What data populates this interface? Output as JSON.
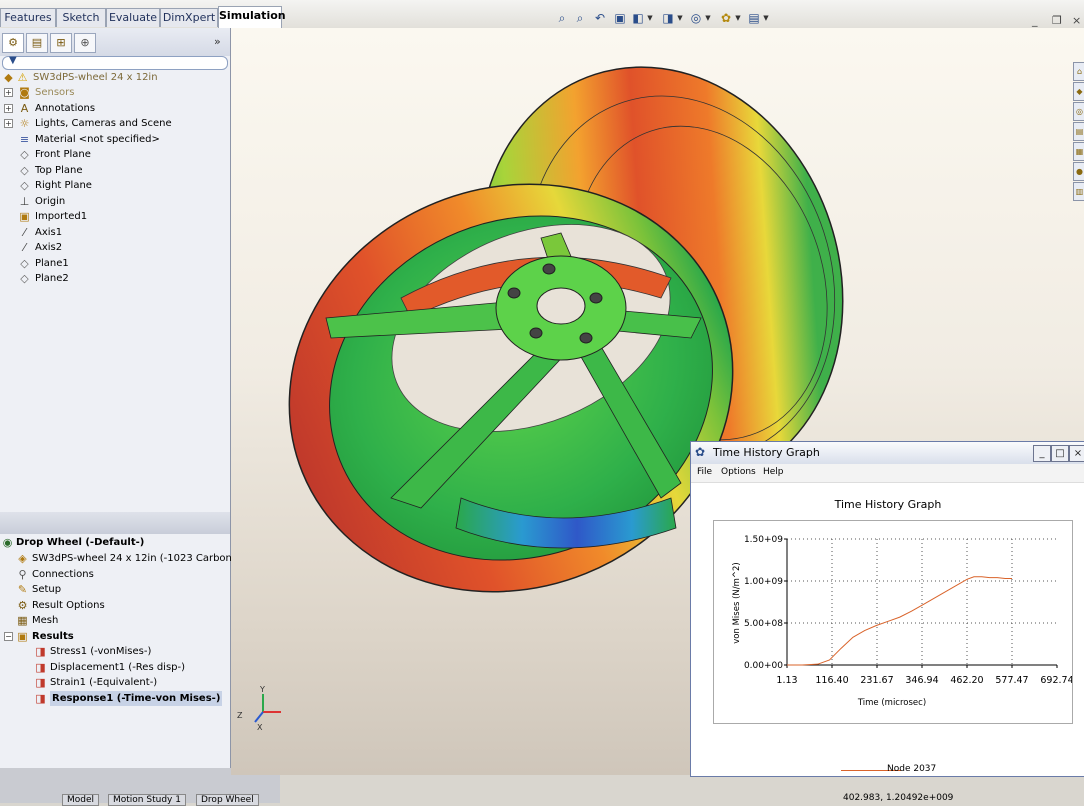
{
  "command_tabs": [
    "Features",
    "Sketch",
    "Evaluate",
    "DimXpert",
    "Simulation"
  ],
  "active_tab": "Simulation",
  "view_toolbar": [
    "zoom-to-fit-icon",
    "zoom-area-icon",
    "previous-view-icon",
    "section-view-icon",
    "view-orientation-icon",
    "display-style-icon",
    "hide-show-icon",
    "edit-appearance-icon",
    "apply-scene-icon",
    "view-settings-icon"
  ],
  "feature_tree": {
    "root": "SW3dPS-wheel 24 x 12in",
    "items": [
      {
        "label": "Sensors",
        "icon": "sensors-icon",
        "expandable": true,
        "muted": true
      },
      {
        "label": "Annotations",
        "icon": "annotations-icon",
        "expandable": true
      },
      {
        "label": "Lights, Cameras and Scene",
        "icon": "lights-icon",
        "expandable": true
      },
      {
        "label": "Material <not specified>",
        "icon": "material-icon",
        "expandable": false
      },
      {
        "label": "Front Plane",
        "icon": "plane-icon",
        "expandable": false
      },
      {
        "label": "Top Plane",
        "icon": "plane-icon",
        "expandable": false
      },
      {
        "label": "Right Plane",
        "icon": "plane-icon",
        "expandable": false
      },
      {
        "label": "Origin",
        "icon": "origin-icon",
        "expandable": false
      },
      {
        "label": "Imported1",
        "icon": "imported-icon",
        "expandable": false
      },
      {
        "label": "Axis1",
        "icon": "axis-icon",
        "expandable": false
      },
      {
        "label": "Axis2",
        "icon": "axis-icon",
        "expandable": false
      },
      {
        "label": "Plane1",
        "icon": "plane-icon",
        "expandable": false
      },
      {
        "label": "Plane2",
        "icon": "plane-icon",
        "expandable": false
      }
    ]
  },
  "sim_tree": {
    "root": "Drop Wheel (-Default-)",
    "items": [
      {
        "label": "SW3dPS-wheel 24 x 12in (-1023 Carbon Steel S",
        "icon": "part-icon",
        "bold": false
      },
      {
        "label": "Connections",
        "icon": "connections-icon",
        "bold": false
      },
      {
        "label": "Setup",
        "icon": "setup-icon",
        "bold": false
      },
      {
        "label": "Result Options",
        "icon": "result-options-icon",
        "bold": false
      },
      {
        "label": "Mesh",
        "icon": "mesh-icon",
        "bold": false
      },
      {
        "label": "Results",
        "icon": "results-folder-icon",
        "bold": true
      },
      {
        "label": "Stress1 (-vonMises-)",
        "icon": "plot-icon",
        "bold": false
      },
      {
        "label": "Displacement1 (-Res disp-)",
        "icon": "plot-icon",
        "bold": false
      },
      {
        "label": "Strain1 (-Equivalent-)",
        "icon": "plot-icon",
        "bold": false
      },
      {
        "label": "Response1 (-Time-von Mises-)",
        "icon": "plot-icon",
        "bold": true
      }
    ]
  },
  "bottom_tabs": [
    "Model",
    "Motion Study 1",
    "Drop Wheel"
  ],
  "triad": {
    "x": "X",
    "y": "Y",
    "z": "Z"
  },
  "time_history_window": {
    "title": "Time History Graph",
    "menu": [
      "File",
      "Options",
      "Help"
    ],
    "buttons": {
      "minimize": "_",
      "maximize": "□",
      "close": "×"
    }
  },
  "chart_data": {
    "type": "line",
    "title": "Time History Graph",
    "xlabel": "Time (microsec)",
    "ylabel": "von Mises (N/m^2)",
    "x_ticks": [
      "1.13",
      "116.40",
      "231.67",
      "346.94",
      "462.20",
      "577.47",
      "692.74"
    ],
    "y_ticks": [
      "0.00+00",
      "5.00+08",
      "1.00+09",
      "1.50+09"
    ],
    "xlim": [
      1.13,
      692.74
    ],
    "ylim": [
      0,
      1500000000.0
    ],
    "grid": true,
    "series": [
      {
        "name": "Node 2037",
        "color": "#d9632a",
        "x": [
          1.13,
          40,
          80,
          110,
          140,
          170,
          200,
          230,
          260,
          290,
          320,
          350,
          380,
          410,
          440,
          462.2,
          480,
          500,
          520,
          540,
          560,
          577.47
        ],
        "y": [
          0,
          0,
          10000000.0,
          60000000.0,
          200000000.0,
          330000000.0,
          410000000.0,
          470000000.0,
          520000000.0,
          570000000.0,
          640000000.0,
          720000000.0,
          800000000.0,
          880000000.0,
          960000000.0,
          1020000000.0,
          1050000000.0,
          1050000000.0,
          1040000000.0,
          1040000000.0,
          1030000000.0,
          1030000000.0
        ]
      }
    ],
    "legend_position": "bottom"
  },
  "cursor_readout": "402.983, 1.20492e+009"
}
